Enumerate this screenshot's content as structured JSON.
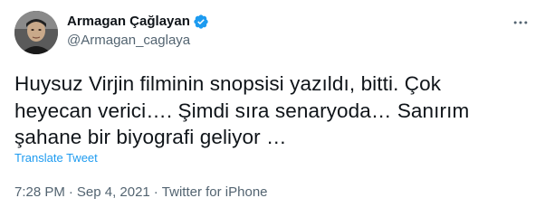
{
  "user": {
    "display_name": "Armagan Çağlayan",
    "handle": "@Armagan_caglaya",
    "verified_icon": "verified-badge-icon",
    "accent_color": "#1d9bf0"
  },
  "tweet": {
    "text": "Huysuz Virjin filminin snopsisi yazıldı, bitti. Çok\nheyecan verici…. Şimdi sıra senaryoda… Sanırım\nşahane bir biyografi geliyor …",
    "translate_label": "Translate Tweet",
    "time": "7:28 PM",
    "date": "Sep 4, 2021",
    "separator": "·",
    "source": "Twitter for iPhone"
  },
  "icons": {
    "more": "more-options-icon",
    "avatar": "avatar"
  }
}
